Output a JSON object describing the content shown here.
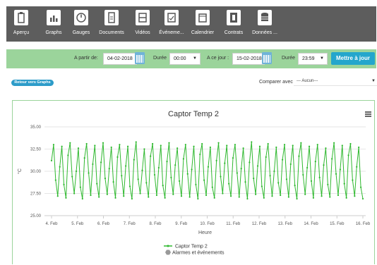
{
  "nav": [
    {
      "label": "Aperçu",
      "icon": "clipboard-icon"
    },
    {
      "label": "Graphs",
      "icon": "bar-chart-icon"
    },
    {
      "label": "Gauges",
      "icon": "gauge-icon"
    },
    {
      "label": "Documents",
      "icon": "document-icon"
    },
    {
      "label": "Vidéos",
      "icon": "video-icon"
    },
    {
      "label": "Événeme...",
      "icon": "event-icon"
    },
    {
      "label": "Calendrier",
      "icon": "calendar-icon"
    },
    {
      "label": "Contrats",
      "icon": "contract-icon"
    },
    {
      "label": "Données ...",
      "icon": "database-icon"
    }
  ],
  "filters": {
    "from_label": "A partir de:",
    "from_value": "04-02-2018",
    "duration_label_1": "Durée",
    "duration_value_1": "00:00",
    "to_label": "A ce jour :",
    "to_value": "15-02-2018",
    "duration_label_2": "Durée",
    "duration_value_2": "23:59",
    "update_button": "Mettre à jour"
  },
  "back_button": "Retour vers Graphs",
  "compare": {
    "label": "Comparer avec",
    "value": "--- Aucun---"
  },
  "chart_data": {
    "type": "line",
    "title": "Captor Temp 2",
    "xlabel": "Heure",
    "ylabel": "°C",
    "ylim": [
      25,
      35
    ],
    "yticks": [
      "35.00",
      "32.50",
      "30.00",
      "27.50",
      "25.00"
    ],
    "xticks": [
      "4. Feb",
      "5. Feb",
      "6. Feb",
      "7. Feb",
      "8. Feb",
      "9. Feb",
      "10. Feb",
      "11. Feb",
      "12. Feb",
      "13. Feb",
      "14. Feb",
      "15. Feb",
      "16. Feb"
    ],
    "series": [
      {
        "name": "Captor Temp 2",
        "color": "#2eb82e",
        "pattern_min": 26.8,
        "pattern_max": 33.3,
        "cycles_per_day": 3,
        "values": [
          31.2,
          33.0,
          29.0,
          27.2,
          30.5,
          32.8,
          28.5,
          27.0,
          31.8,
          33.2,
          29.4,
          27.5,
          30.0,
          32.6,
          28.2,
          26.9,
          31.5,
          33.1,
          29.8,
          27.3,
          30.8,
          32.9,
          28.6,
          27.1,
          31.0,
          33.2,
          29.2,
          27.4,
          30.3,
          32.7,
          28.8,
          27.0,
          31.6,
          33.0,
          29.5,
          27.2,
          30.6,
          32.8,
          28.3,
          26.9,
          31.3,
          33.3,
          29.1,
          27.5,
          30.1,
          32.5,
          28.7,
          27.1,
          31.7,
          33.1,
          29.6,
          27.3,
          30.4,
          32.9,
          28.4,
          27.0,
          31.1,
          33.2,
          29.3,
          27.4,
          30.7,
          32.6,
          28.9,
          27.2,
          31.4,
          33.0,
          29.7,
          27.1,
          30.2,
          32.8,
          28.5,
          26.9,
          31.9,
          33.1,
          29.0,
          27.3,
          30.5,
          32.7,
          28.2,
          27.0,
          31.2,
          33.2,
          29.4,
          27.5,
          30.9,
          32.9,
          28.6,
          27.2,
          31.5,
          33.0,
          29.8,
          27.1,
          30.3,
          32.6,
          28.8,
          26.9,
          31.0,
          33.3,
          29.2,
          27.4,
          30.6,
          32.8,
          28.3,
          27.0,
          31.6,
          33.1,
          29.5,
          27.2,
          30.0,
          32.7,
          28.7,
          27.3,
          31.3,
          33.0,
          29.1,
          27.1,
          30.8,
          32.9,
          28.4,
          26.9,
          31.7,
          33.2,
          29.6,
          27.4,
          30.4,
          32.8,
          28.9,
          27.0,
          31.1,
          33.0,
          29.3,
          27.2,
          30.7,
          32.6,
          28.5,
          27.1,
          31.4,
          33.2,
          29.7,
          27.3,
          30.2,
          32.9,
          28.6,
          27.0,
          31.8,
          33.1,
          29.0,
          27.2,
          30.5,
          32.7,
          28.2,
          26.9
        ]
      }
    ],
    "legend": [
      {
        "label": "Captor Temp 2",
        "color": "#2eb82e",
        "marker": "line"
      },
      {
        "label": "Alarmes et événements",
        "color": "#999999",
        "marker": "hexagon"
      }
    ],
    "legend_position": "bottom-center"
  }
}
